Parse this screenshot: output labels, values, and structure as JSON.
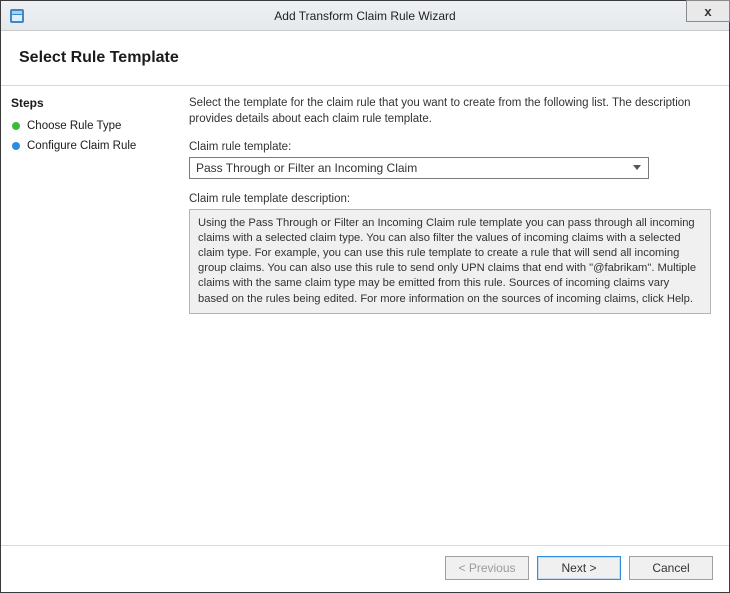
{
  "window": {
    "title": "Add Transform Claim Rule Wizard",
    "close_label": "x"
  },
  "header": {
    "title": "Select Rule Template"
  },
  "sidebar": {
    "heading": "Steps",
    "items": [
      {
        "label": "Choose Rule Type",
        "state": "done"
      },
      {
        "label": "Configure Claim Rule",
        "state": "current"
      }
    ]
  },
  "main": {
    "intro": "Select the template for the claim rule that you want to create from the following list. The description provides details about each claim rule template.",
    "template_label": "Claim rule template:",
    "template_selected": "Pass Through or Filter an Incoming Claim",
    "desc_label": "Claim rule template description:",
    "desc_text": "Using the Pass Through or Filter an Incoming Claim rule template you can pass through all incoming claims with a selected claim type.  You can also filter the values of incoming claims with a selected claim type.  For example, you can use this rule template to create a rule that will send all incoming group claims.  You can also use this rule to send only UPN claims that end with \"@fabrikam\".  Multiple claims with the same claim type may be emitted from this rule.  Sources of incoming claims vary based on the rules being edited.  For more information on the sources of incoming claims, click Help."
  },
  "footer": {
    "previous_label": "< Previous",
    "next_label": "Next >",
    "cancel_label": "Cancel"
  }
}
